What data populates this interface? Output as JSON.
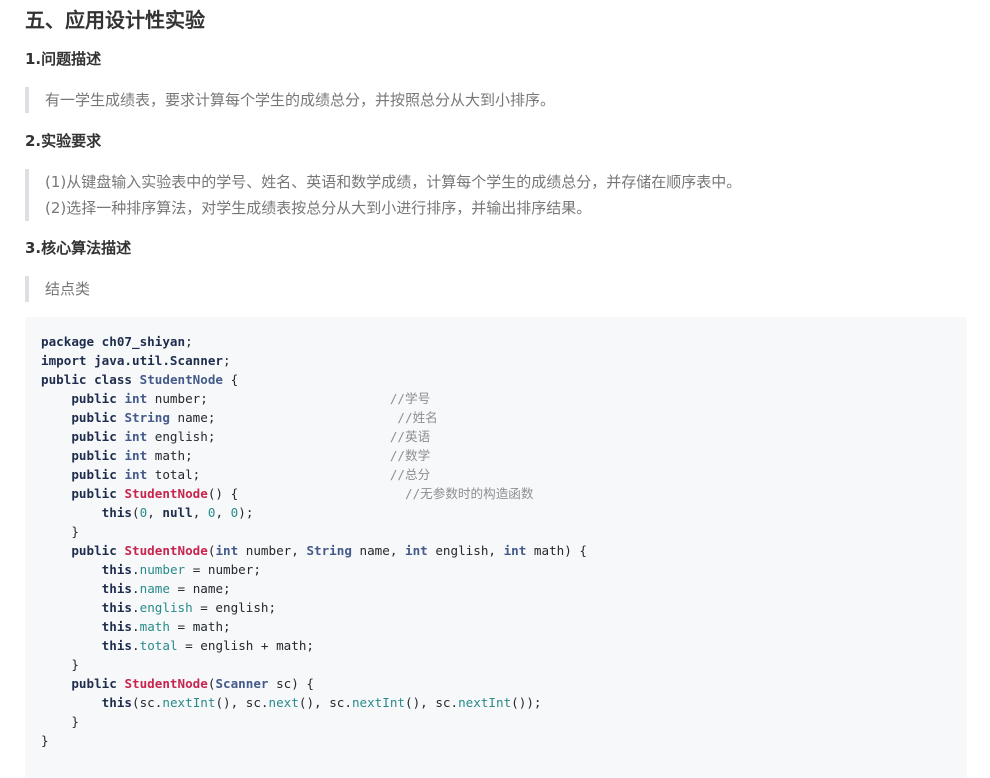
{
  "section_title": "五、应用设计性实验",
  "problem": {
    "heading": "1.问题描述",
    "text": "有一学生成绩表，要求计算每个学生的成绩总分，并按照总分从大到小排序。"
  },
  "requirements": {
    "heading": "2.实验要求",
    "items": [
      "(1)从键盘输入实验表中的学号、姓名、英语和数学成绩，计算每个学生的成绩总分，并存储在顺序表中。",
      "(2)选择一种排序算法，对学生成绩表按总分从大到小进行排序，并输出排序结果。"
    ]
  },
  "algorithm": {
    "heading": "3.核心算法描述",
    "note": "结点类"
  },
  "code": {
    "language": "java",
    "lines": [
      [
        [
          "k",
          "package"
        ],
        [
          "x",
          " "
        ],
        [
          "n",
          "ch07_shiyan"
        ],
        [
          "x",
          ";"
        ]
      ],
      [
        [
          "k",
          "import"
        ],
        [
          "x",
          " "
        ],
        [
          "n",
          "java.util.Scanner"
        ],
        [
          "x",
          ";"
        ]
      ],
      [
        [
          "k",
          "public"
        ],
        [
          "x",
          " "
        ],
        [
          "k",
          "class"
        ],
        [
          "x",
          " "
        ],
        [
          "t",
          "StudentNode"
        ],
        [
          "x",
          " {"
        ]
      ],
      [
        [
          "x",
          "    "
        ],
        [
          "k",
          "public"
        ],
        [
          "x",
          " "
        ],
        [
          "t",
          "int"
        ],
        [
          "x",
          " number;                        "
        ],
        [
          "c",
          "//学号"
        ]
      ],
      [
        [
          "x",
          "    "
        ],
        [
          "k",
          "public"
        ],
        [
          "x",
          " "
        ],
        [
          "t",
          "String"
        ],
        [
          "x",
          " name;                        "
        ],
        [
          "c",
          "//姓名"
        ]
      ],
      [
        [
          "x",
          "    "
        ],
        [
          "k",
          "public"
        ],
        [
          "x",
          " "
        ],
        [
          "t",
          "int"
        ],
        [
          "x",
          " english;                       "
        ],
        [
          "c",
          "//英语"
        ]
      ],
      [
        [
          "x",
          "    "
        ],
        [
          "k",
          "public"
        ],
        [
          "x",
          " "
        ],
        [
          "t",
          "int"
        ],
        [
          "x",
          " math;                          "
        ],
        [
          "c",
          "//数学"
        ]
      ],
      [
        [
          "x",
          "    "
        ],
        [
          "k",
          "public"
        ],
        [
          "x",
          " "
        ],
        [
          "t",
          "int"
        ],
        [
          "x",
          " total;                         "
        ],
        [
          "c",
          "//总分"
        ]
      ],
      [
        [
          "x",
          "    "
        ],
        [
          "k",
          "public"
        ],
        [
          "x",
          " "
        ],
        [
          "f",
          "StudentNode"
        ],
        [
          "x",
          "() {                      "
        ],
        [
          "c",
          "//无参数时的构造函数"
        ]
      ],
      [
        [
          "x",
          "        "
        ],
        [
          "k",
          "this"
        ],
        [
          "x",
          "("
        ],
        [
          "num",
          "0"
        ],
        [
          "x",
          ", "
        ],
        [
          "k",
          "null"
        ],
        [
          "x",
          ", "
        ],
        [
          "num",
          "0"
        ],
        [
          "x",
          ", "
        ],
        [
          "num",
          "0"
        ],
        [
          "x",
          ");"
        ]
      ],
      [
        [
          "x",
          "    }"
        ]
      ],
      [
        [
          "x",
          "    "
        ],
        [
          "k",
          "public"
        ],
        [
          "x",
          " "
        ],
        [
          "f",
          "StudentNode"
        ],
        [
          "x",
          "("
        ],
        [
          "t",
          "int"
        ],
        [
          "x",
          " number, "
        ],
        [
          "t",
          "String"
        ],
        [
          "x",
          " name, "
        ],
        [
          "t",
          "int"
        ],
        [
          "x",
          " english, "
        ],
        [
          "t",
          "int"
        ],
        [
          "x",
          " math) {"
        ]
      ],
      [
        [
          "x",
          "        "
        ],
        [
          "k",
          "this"
        ],
        [
          "x",
          "."
        ],
        [
          "p",
          "number"
        ],
        [
          "x",
          " = number;"
        ]
      ],
      [
        [
          "x",
          "        "
        ],
        [
          "k",
          "this"
        ],
        [
          "x",
          "."
        ],
        [
          "p",
          "name"
        ],
        [
          "x",
          " = name;"
        ]
      ],
      [
        [
          "x",
          "        "
        ],
        [
          "k",
          "this"
        ],
        [
          "x",
          "."
        ],
        [
          "p",
          "english"
        ],
        [
          "x",
          " = english;"
        ]
      ],
      [
        [
          "x",
          "        "
        ],
        [
          "k",
          "this"
        ],
        [
          "x",
          "."
        ],
        [
          "p",
          "math"
        ],
        [
          "x",
          " = math;"
        ]
      ],
      [
        [
          "x",
          "        "
        ],
        [
          "k",
          "this"
        ],
        [
          "x",
          "."
        ],
        [
          "p",
          "total"
        ],
        [
          "x",
          " = english + math;"
        ]
      ],
      [
        [
          "x",
          "    }"
        ]
      ],
      [
        [
          "x",
          "    "
        ],
        [
          "k",
          "public"
        ],
        [
          "x",
          " "
        ],
        [
          "f",
          "StudentNode"
        ],
        [
          "x",
          "("
        ],
        [
          "t",
          "Scanner"
        ],
        [
          "x",
          " sc) {"
        ]
      ],
      [
        [
          "x",
          "        "
        ],
        [
          "k",
          "this"
        ],
        [
          "x",
          "(sc."
        ],
        [
          "p",
          "nextInt"
        ],
        [
          "x",
          "(), sc."
        ],
        [
          "p",
          "next"
        ],
        [
          "x",
          "(), sc."
        ],
        [
          "p",
          "nextInt"
        ],
        [
          "x",
          "(), sc."
        ],
        [
          "p",
          "nextInt"
        ],
        [
          "x",
          "());"
        ]
      ],
      [
        [
          "x",
          "    }"
        ]
      ],
      [
        [
          "x",
          "}"
        ]
      ]
    ]
  },
  "colors": {
    "heading": "#333333",
    "quote_text": "#777777",
    "quote_border": "#dddfe4",
    "code_bg": "#f6f8fa",
    "keyword": "#1f2d4d",
    "type": "#445a8a",
    "function": "#c7254e",
    "property": "#2a8a8a",
    "comment": "#8f8f8f"
  }
}
